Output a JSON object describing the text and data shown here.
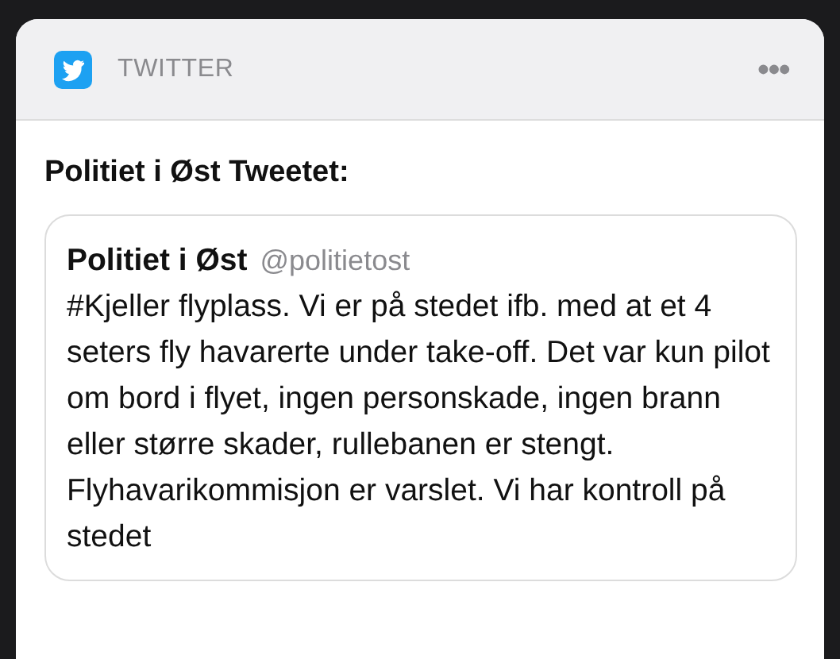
{
  "app": {
    "name": "TWITTER",
    "more": "•••"
  },
  "headline": "Politiet i Øst Tweetet:",
  "tweet": {
    "author": "Politiet i Øst",
    "handle": "@politietost",
    "text": "#Kjeller flyplass. Vi er på stedet ifb. med at et 4 seters fly havarerte under take-off. Det var kun pilot om bord i flyet, ingen personskade, ingen brann eller større skader, rullebanen er stengt. Flyhavarikommisjon er varslet. Vi har kontroll på stedet"
  }
}
